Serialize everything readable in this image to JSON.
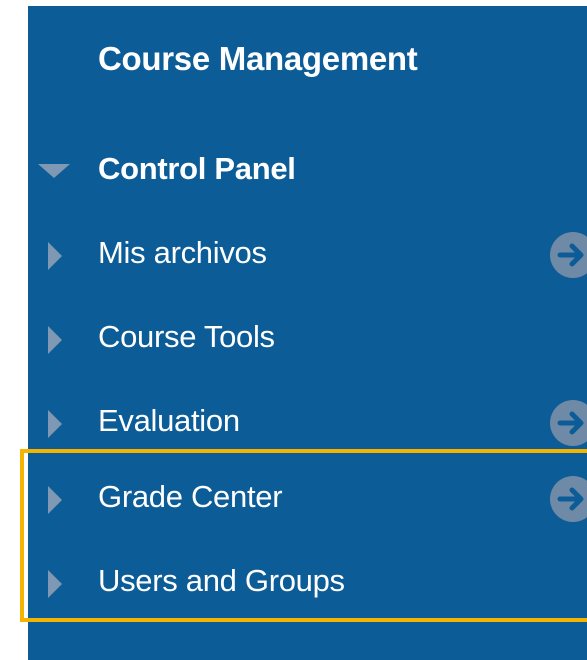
{
  "panel": {
    "title": "Course Management",
    "items": [
      {
        "label": "Control Panel",
        "expanded": true,
        "bold": true,
        "has_action": false
      },
      {
        "label": "Mis archivos",
        "expanded": false,
        "bold": false,
        "has_action": true
      },
      {
        "label": "Course Tools",
        "expanded": false,
        "bold": false,
        "has_action": false
      },
      {
        "label": "Evaluation",
        "expanded": false,
        "bold": false,
        "has_action": true
      },
      {
        "label": "Grade Center",
        "expanded": false,
        "bold": false,
        "has_action": true,
        "highlighted": true
      },
      {
        "label": "Users and Groups",
        "expanded": false,
        "bold": false,
        "has_action": false,
        "highlighted": true
      }
    ],
    "icons": {
      "expanded": "triangle-down-icon",
      "collapsed": "triangle-right-icon",
      "action": "arrow-circle-right-icon"
    }
  },
  "colors": {
    "panel_background": "#0c5c97",
    "text": "#ffffff",
    "toggle_triangle": "#7f98b3",
    "action_circle": "#6f8aa7",
    "highlight_border": "#f5b400"
  }
}
